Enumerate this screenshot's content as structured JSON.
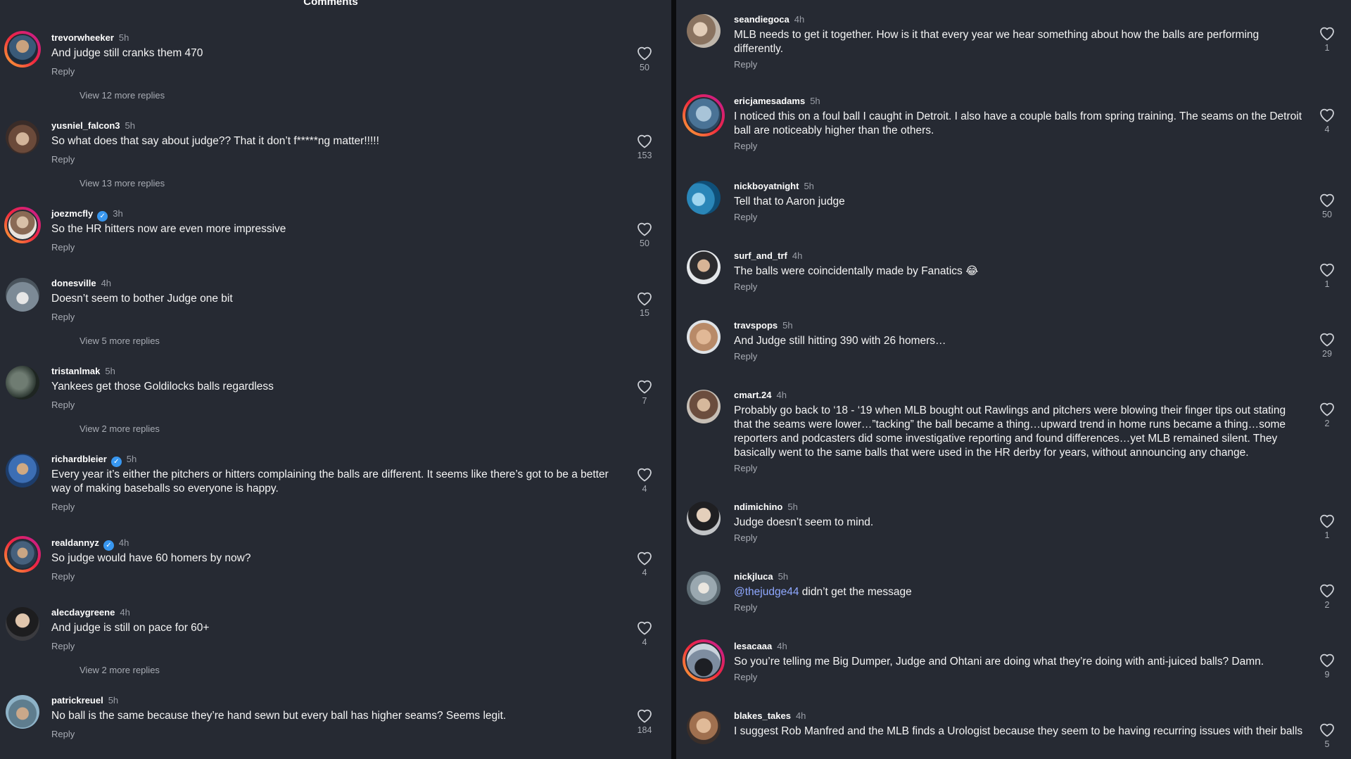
{
  "left_panel": {
    "title": "Comments",
    "reply_label": "Reply",
    "comments": [
      {
        "username": "trevorwheeker",
        "verified": false,
        "time": "5h",
        "text": "And judge still cranks them 470",
        "likes": "50",
        "view_more": "View 12 more replies"
      },
      {
        "username": "yusniel_falcon3",
        "verified": false,
        "time": "5h",
        "text": "So what does that say about judge?? That it don’t f*****ng matter!!!!!",
        "likes": "153",
        "view_more": "View 13 more replies"
      },
      {
        "username": "joezmcfly",
        "verified": true,
        "time": "3h",
        "text": "So the HR hitters now are even more impressive",
        "likes": "50",
        "view_more": ""
      },
      {
        "username": "donesville",
        "verified": false,
        "time": "4h",
        "text": "Doesn’t seem to bother Judge one bit",
        "likes": "15",
        "view_more": "View 5 more replies"
      },
      {
        "username": "tristanlmak",
        "verified": false,
        "time": "5h",
        "text": "Yankees get those Goldilocks balls regardless",
        "likes": "7",
        "view_more": "View 2 more replies"
      },
      {
        "username": "richardbleier",
        "verified": true,
        "time": "5h",
        "text": "Every year it’s either the pitchers or hitters complaining the balls are different. It seems like there’s got to be a better way of making baseballs so everyone is happy.",
        "likes": "4",
        "view_more": ""
      },
      {
        "username": "realdannyz",
        "verified": true,
        "time": "4h",
        "text": "So judge would have 60 homers by now?",
        "likes": "4",
        "view_more": ""
      },
      {
        "username": "alecdaygreene",
        "verified": false,
        "time": "4h",
        "text": "And judge is still on pace for 60+",
        "likes": "4",
        "view_more": "View 2 more replies"
      },
      {
        "username": "patrickreuel",
        "verified": false,
        "time": "5h",
        "text": "No ball is the same because they’re hand sewn but every ball has higher seams? Seems legit.",
        "likes": "184",
        "view_more": ""
      }
    ]
  },
  "right_panel": {
    "reply_label": "Reply",
    "comments": [
      {
        "username": "seandiegoca",
        "time": "4h",
        "text": "MLB needs to get it together. How is it that every year we hear something about how the balls are performing differently.",
        "likes": "1"
      },
      {
        "username": "ericjamesadams",
        "time": "5h",
        "text": "I noticed this on a foul ball I caught in Detroit. I also have a couple balls from spring training. The seams on the Detroit ball are noticeably higher than the others.",
        "likes": "4"
      },
      {
        "username": "nickboyatnight",
        "time": "5h",
        "text": "Tell that to Aaron judge",
        "likes": "50"
      },
      {
        "username": "surf_and_trf",
        "time": "4h",
        "text": "The balls were coincidentally made by Fanatics 😂",
        "likes": "1"
      },
      {
        "username": "travspops",
        "time": "5h",
        "text": "And Judge still hitting 390 with 26 homers…",
        "likes": "29"
      },
      {
        "username": "cmart.24",
        "time": "4h",
        "text": "Probably go back to ‘18 - ‘19 when MLB bought out Rawlings and pitchers were blowing their finger tips out stating that the seams were lower…”tacking” the ball became a thing…upward trend in home runs became a thing…some reporters and podcasters did some investigative reporting and found differences…yet MLB remained silent.  They basically went to the same balls that were used in the HR derby for years, without announcing any change.",
        "likes": "2"
      },
      {
        "username": "ndimichino",
        "time": "5h",
        "text": "Judge doesn’t seem to mind.",
        "likes": "1"
      },
      {
        "username": "nickjluca",
        "time": "5h",
        "mention": "@thejudge44",
        "text": " didn’t get the message",
        "likes": "2"
      },
      {
        "username": "lesacaaa",
        "time": "4h",
        "text": "So you’re telling me Big Dumper, Judge and Ohtani are doing what they’re doing with anti-juiced balls? Damn.",
        "likes": "9"
      },
      {
        "username": "blakes_takes",
        "time": "4h",
        "text": "I suggest Rob Manfred and the MLB finds a Urologist because they seem to be having recurring issues with their balls",
        "likes": "5"
      }
    ]
  },
  "colors": {
    "background": "#262a33",
    "divider": "#0b0c0e",
    "mention": "#8fa8ff",
    "verified": "#3897f0"
  },
  "icons": {
    "like": "heart-outline-icon",
    "verified": "verified-badge-icon"
  }
}
